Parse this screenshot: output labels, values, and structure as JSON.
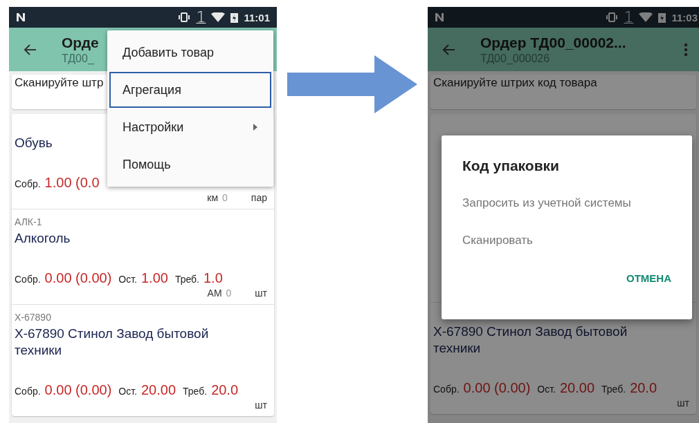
{
  "left_screen": {
    "status_bar": {
      "sim": "1",
      "time": "11:01"
    },
    "toolbar": {
      "title": "Орде",
      "subtitle": "ТД00_"
    },
    "scan_field": {
      "placeholder": "Сканируйте штр"
    },
    "items": [
      {
        "name": "Обувь",
        "collected_label": "Собр.",
        "collected": "1.00 (0.0",
        "mark_label": "км",
        "mark_count": "0",
        "unit": "пар"
      },
      {
        "code": "АЛК-1",
        "name": "Алкоголь",
        "collected_label": "Собр.",
        "collected": "0.00 (0.00)",
        "remaining_label": "Ост.",
        "remaining": "1.00",
        "required_label": "Треб.",
        "required": "1.0",
        "mark_label": "АМ",
        "mark_count": "0",
        "unit": "шт"
      },
      {
        "code": "Х-67890",
        "name": "Х-67890 Стинол Завод бытовой техники",
        "collected_label": "Собр.",
        "collected": "0.00 (0.00)",
        "remaining_label": "Ост.",
        "remaining": "20.00",
        "required_label": "Треб.",
        "required": "20.0",
        "unit": "шт"
      }
    ],
    "menu": {
      "items": [
        {
          "label": "Добавить товар",
          "selected": false,
          "submenu": false
        },
        {
          "label": "Агрегация",
          "selected": true,
          "submenu": false
        },
        {
          "label": "Настройки",
          "selected": false,
          "submenu": true
        },
        {
          "label": "Помощь",
          "selected": false,
          "submenu": false
        }
      ]
    }
  },
  "right_screen": {
    "status_bar": {
      "sim": "1",
      "time": "11:03"
    },
    "toolbar": {
      "title": "Ордер ТД00_00002...",
      "subtitle": "ТД00_000026"
    },
    "scan_field": {
      "placeholder": "Сканируйте штрих код товара"
    },
    "items": [
      {
        "name": "Х-67890 Стинол Завод бытовой техники",
        "collected_label": "Собр.",
        "collected": "0.00 (0.00)",
        "remaining_label": "Ост.",
        "remaining": "20.00",
        "required_label": "Треб.",
        "required": "20.0",
        "unit": "шт"
      }
    ],
    "dialog": {
      "title": "Код упаковки",
      "options": [
        "Запросить из учетной системы",
        "Сканировать"
      ],
      "cancel": "ОТМЕНА"
    }
  }
}
